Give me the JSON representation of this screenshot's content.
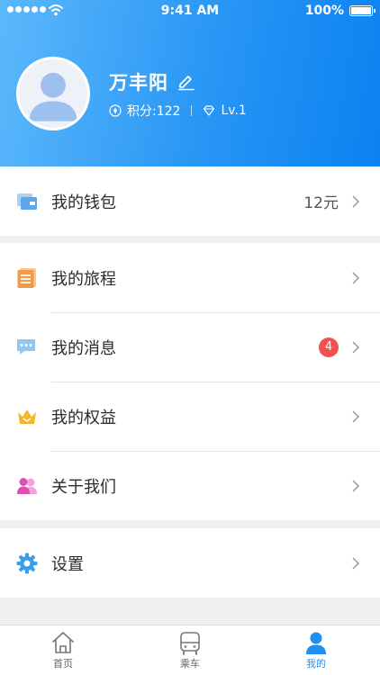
{
  "status_bar": {
    "time": "9:41 AM",
    "battery": "100%"
  },
  "profile": {
    "name": "万丰阳",
    "points": "积分:122",
    "level": "Lv.1"
  },
  "menu": {
    "wallet": {
      "label": "我的钱包",
      "value": "12元",
      "icon": "wallet-icon"
    },
    "trips": {
      "label": "我的旅程",
      "icon": "trip-list-icon"
    },
    "messages": {
      "label": "我的消息",
      "badge": "4",
      "icon": "message-icon"
    },
    "benefits": {
      "label": "我的权益",
      "icon": "crown-icon"
    },
    "about": {
      "label": "关于我们",
      "icon": "people-icon"
    },
    "settings": {
      "label": "设置",
      "icon": "gear-icon"
    }
  },
  "tabbar": {
    "tabs": [
      {
        "label": "首页",
        "icon": "home-icon"
      },
      {
        "label": "乘车",
        "icon": "bus-icon"
      },
      {
        "label": "我的",
        "icon": "user-icon"
      }
    ],
    "active_index": 2
  },
  "colors": {
    "accent": "#1f8ff2",
    "badge": "#f05252",
    "header_start": "#5cb8fb",
    "header_end": "#0a82f0"
  }
}
